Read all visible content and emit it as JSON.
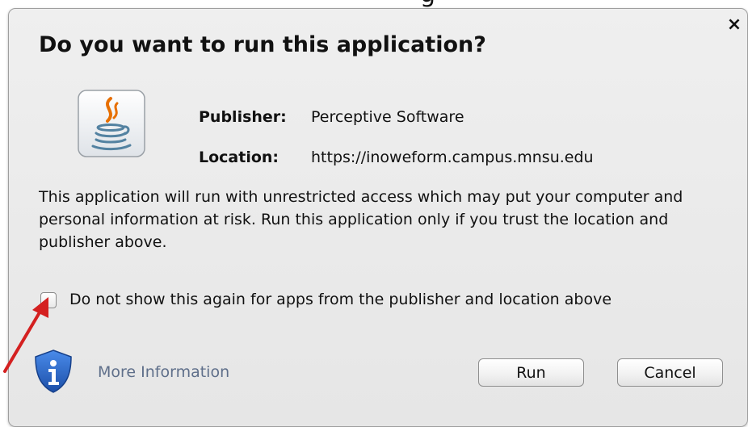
{
  "background": {
    "cutoff_text": "g"
  },
  "dialog": {
    "title": "Do you want to run this application?",
    "close_glyph": "×",
    "publisher_label": "Publisher:",
    "publisher_value": "Perceptive Software",
    "location_label": "Location:",
    "location_value": "https://inoweform.campus.mnsu.edu",
    "warning": "This application will run with unrestricted access which may put your computer and personal information at risk. Run this application only if you trust the location and publisher above.",
    "checkbox": {
      "label": "Do not show this again for apps from the publisher and location above",
      "checked": false
    },
    "more_info_link": "More Information",
    "run_button": "Run",
    "cancel_button": "Cancel"
  },
  "icons": {
    "app_icon": "java-coffee-cup-icon",
    "info_icon": "info-shield-icon",
    "annotation": "red-arrow-icon",
    "close": "close-icon"
  },
  "colors": {
    "dialog_bg": "#e9e9e9",
    "link": "#5f6f8a",
    "arrow": "#d42020",
    "shield": "#2d6fd0",
    "java_orange": "#e76f00",
    "java_blue": "#5382a1"
  }
}
